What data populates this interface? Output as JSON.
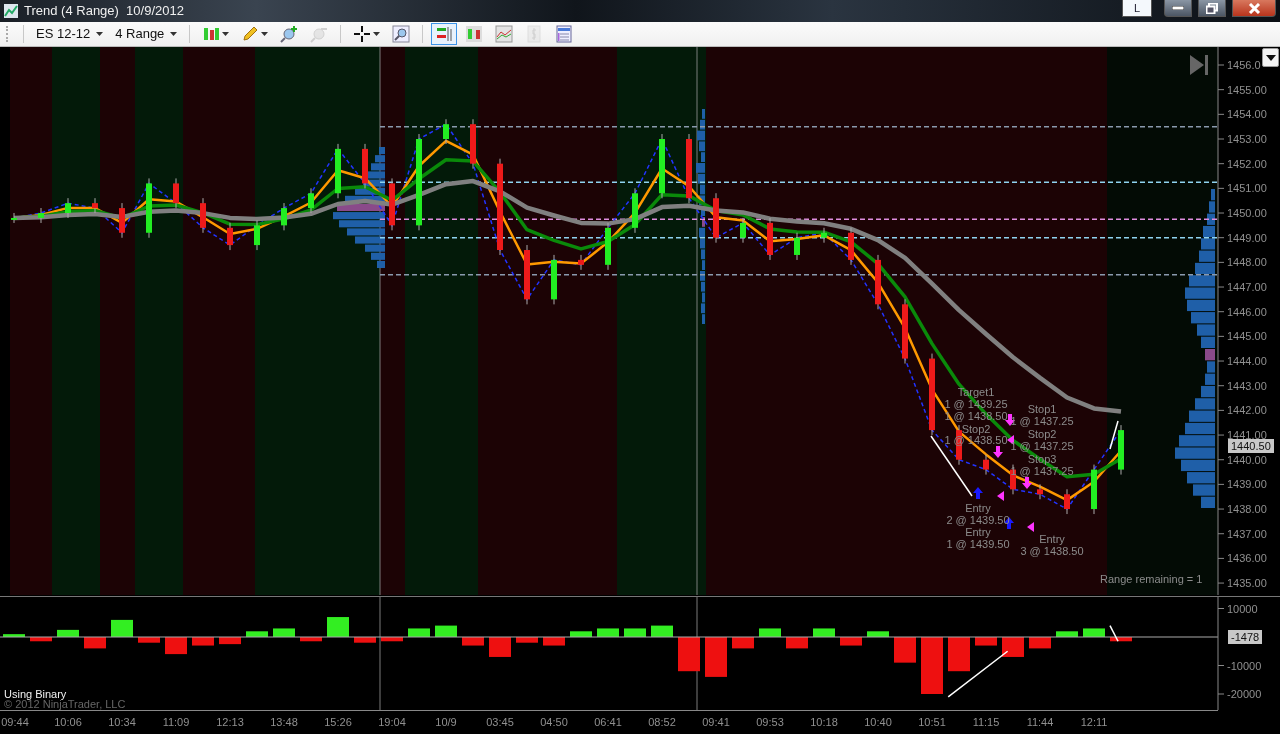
{
  "window": {
    "title": "Trend (4 Range)  10/9/2012",
    "buttons": [
      {
        "kind": "layout",
        "label": "L"
      },
      {
        "kind": "minimize"
      },
      {
        "kind": "restore"
      },
      {
        "kind": "close"
      }
    ]
  },
  "toolbar": {
    "instrument": "ES 12-12",
    "interval": "4 Range",
    "buttons": [
      {
        "kind": "candles",
        "dropdown": true,
        "disabled": false,
        "selected": false
      },
      {
        "kind": "pencil",
        "dropdown": true,
        "disabled": false,
        "selected": false
      },
      {
        "kind": "zoom-in",
        "dropdown": false,
        "disabled": false,
        "selected": false
      },
      {
        "kind": "zoom-out",
        "dropdown": false,
        "disabled": true,
        "selected": false
      },
      {
        "kind": "crosshair",
        "dropdown": true,
        "disabled": false,
        "selected": false
      },
      {
        "kind": "zoom-box",
        "dropdown": false,
        "disabled": false,
        "selected": false
      },
      {
        "kind": "data-box",
        "dropdown": false,
        "disabled": false,
        "selected": true
      },
      {
        "kind": "bar-chart",
        "dropdown": false,
        "disabled": false,
        "selected": false
      },
      {
        "kind": "line-chart",
        "dropdown": false,
        "disabled": false,
        "selected": false
      },
      {
        "kind": "dollar",
        "dropdown": false,
        "disabled": true,
        "selected": false
      },
      {
        "kind": "properties",
        "dropdown": false,
        "disabled": false,
        "selected": false
      }
    ]
  },
  "price_panel": {
    "axis_labels": [
      "1456.0",
      "1455.00",
      "1454.00",
      "1453.00",
      "1452.00",
      "1451.00",
      "1450.00",
      "1449.00",
      "1448.00",
      "1447.00",
      "1446.00",
      "1445.00",
      "1444.00",
      "1443.00",
      "1442.00",
      "1441.00",
      "1440.00",
      "1439.00",
      "1438.00",
      "1437.00",
      "1436.00",
      "1435.00"
    ],
    "current_price": "1440.50",
    "status": "Range remaining = 1",
    "trade_labels": [
      "Target1",
      "1 @ 1439.25",
      "Stop1",
      "1 @ 1438.50",
      "1 @ 1437.25",
      "Stop2",
      "Stop2",
      "1 @ 1438.50",
      "1 @ 1437.25",
      "Stop3",
      "1 @ 1437.25",
      "Entry",
      "2 @ 1439.50",
      "Entry",
      "1 @ 1439.50",
      "Entry",
      "3 @ 1438.50"
    ]
  },
  "indicator_panel": {
    "axis_labels": [
      "10000",
      "-10000",
      "-20000"
    ],
    "current_value": "-1478",
    "label": "Using Binary",
    "copyright": "© 2012 NinjaTrader, LLC"
  },
  "time_axis": {
    "labels": [
      "09:44",
      "10:06",
      "10:34",
      "11:09",
      "12:13",
      "13:48",
      "15:26",
      "19:04",
      "10/9",
      "03:45",
      "04:50",
      "06:41",
      "08:52",
      "09:41",
      "09:53",
      "10:18",
      "10:40",
      "10:51",
      "11:15",
      "11:44",
      "12:11"
    ]
  }
}
